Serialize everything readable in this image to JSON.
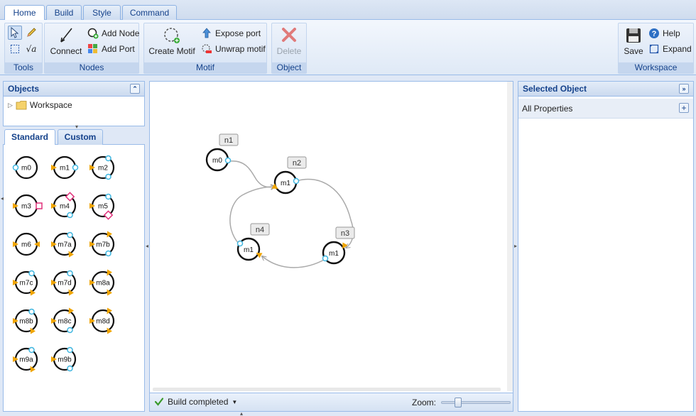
{
  "ribbon": {
    "tabs": [
      {
        "label": "Home",
        "active": true
      },
      {
        "label": "Build",
        "active": false
      },
      {
        "label": "Style",
        "active": false
      },
      {
        "label": "Command",
        "active": false
      }
    ],
    "groups": {
      "tools": {
        "label": "Tools",
        "icons": [
          "pointer-icon",
          "pencil-icon",
          "select-box-icon",
          "sqrt-a-icon"
        ]
      },
      "nodes": {
        "label": "Nodes",
        "connect": "Connect",
        "add_node": "Add Node",
        "add_port": "Add Port"
      },
      "motif": {
        "label": "Motif",
        "create_motif": "Create Motif",
        "expose_port": "Expose port",
        "unwrap_motif": "Unwrap motif"
      },
      "object": {
        "label": "Object",
        "delete": "Delete"
      },
      "workspace": {
        "label": "Workspace",
        "save": "Save",
        "help": "Help",
        "expand": "Expand"
      }
    }
  },
  "objects_panel": {
    "title": "Objects",
    "tree": [
      {
        "label": "Workspace",
        "icon": "folder-icon",
        "expanded": false
      }
    ]
  },
  "palette": {
    "tabs": [
      {
        "label": "Standard",
        "active": true
      },
      {
        "label": "Custom",
        "active": false
      }
    ],
    "items": [
      "m0",
      "m1",
      "m2",
      "m3",
      "m4",
      "m5",
      "m6",
      "m7a",
      "m7b",
      "m7c",
      "m7d",
      "m8a",
      "m8b",
      "m8c",
      "m8d",
      "m9a",
      "m9b"
    ]
  },
  "canvas": {
    "nodes": [
      {
        "id": "n1",
        "label": "m0"
      },
      {
        "id": "n2",
        "label": "m1"
      },
      {
        "id": "n3",
        "label": "m1"
      },
      {
        "id": "n4",
        "label": "m1"
      }
    ],
    "edges": [
      [
        "n1",
        "n2"
      ],
      [
        "n2",
        "n3"
      ],
      [
        "n3",
        "n4"
      ],
      [
        "n4",
        "n2"
      ]
    ]
  },
  "status": {
    "build_text": "Build completed",
    "zoom_label": "Zoom:",
    "zoom_level": 0.2
  },
  "selected_panel": {
    "title": "Selected Object",
    "all_properties": "All Properties"
  },
  "colors": {
    "accent": "#15428b",
    "border": "#99bbe8",
    "port_in": "#f0a500",
    "port_out": "#3fb6e0",
    "port_special": "#e0307a"
  }
}
